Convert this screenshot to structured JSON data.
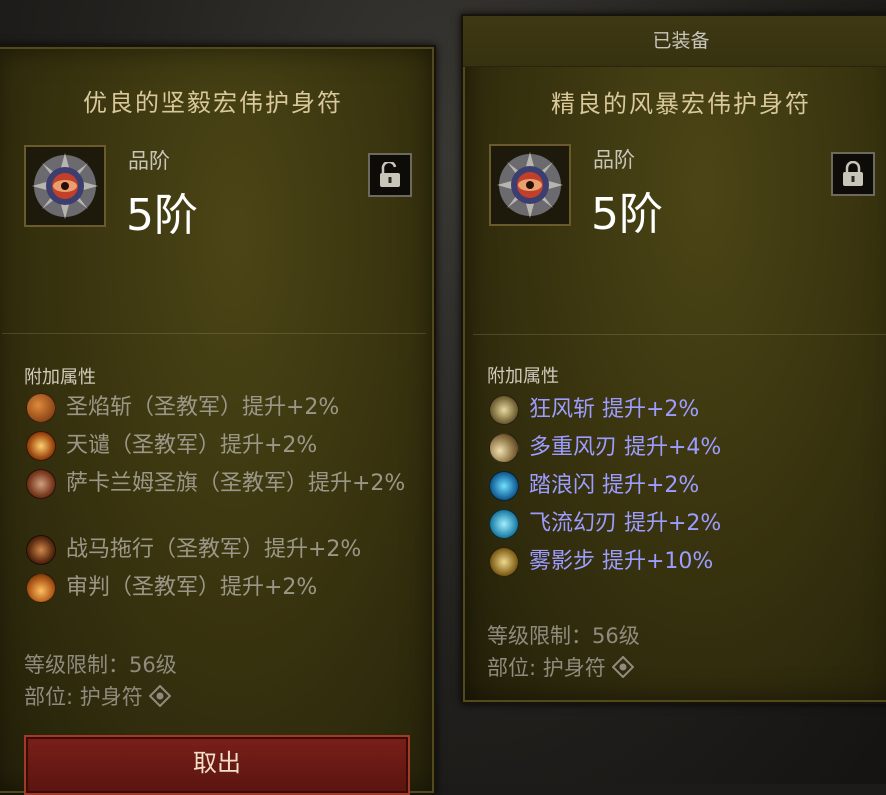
{
  "left_item": {
    "title": "优良的坚毅宏伟护身符",
    "rank_label": "品阶",
    "rank_value": "5阶",
    "affix_header": "附加属性",
    "affixes": [
      {
        "icon": "flame-slash-icon",
        "text": "圣焰斩（圣教军）提升+2%"
      },
      {
        "icon": "heavens-fury-icon",
        "text": "天谴（圣教军）提升+2%"
      },
      {
        "icon": "banner-icon",
        "text": "萨卡兰姆圣旗（圣教军）提升+2%"
      },
      {
        "icon": "steed-charge-icon",
        "text": "战马拖行（圣教军）提升+2%"
      },
      {
        "icon": "judgment-icon",
        "text": "审判（圣教军）提升+2%"
      }
    ],
    "level_req": "等级限制：56级",
    "slot": "部位: 护身符",
    "button_label": "取出",
    "lock_state": "unlocked"
  },
  "right_item": {
    "equipped_label": "已装备",
    "title": "精良的风暴宏伟护身符",
    "rank_label": "品阶",
    "rank_value": "5阶",
    "affix_header": "附加属性",
    "affixes": [
      {
        "icon": "gale-slash-icon",
        "text": "狂风斩  提升+2%"
      },
      {
        "icon": "multi-blade-icon",
        "text": "多重风刃  提升+4%"
      },
      {
        "icon": "wave-dash-icon",
        "text": "踏浪闪  提升+2%"
      },
      {
        "icon": "flowing-blade-icon",
        "text": "飞流幻刃  提升+2%"
      },
      {
        "icon": "mist-step-icon",
        "text": "雾影步  提升+10%"
      }
    ],
    "level_req": "等级限制：56级",
    "slot": "部位: 护身符",
    "lock_state": "locked"
  },
  "colors": {
    "affix_gray": "#9b9788",
    "affix_blue": "#9d9dff",
    "title_gold": "#d9c89a",
    "button_red": "#7a1f1a"
  }
}
